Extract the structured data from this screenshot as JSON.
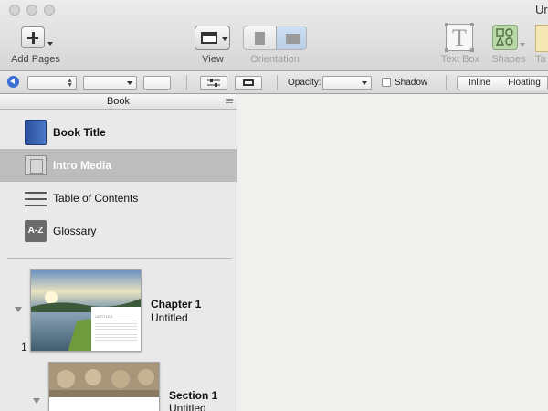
{
  "window": {
    "title": "Ur"
  },
  "toolbar": {
    "add_pages": "Add Pages",
    "view": "View",
    "orientation": "Orientation",
    "text_box": "Text Box",
    "shapes": "Shapes",
    "table_partial": "Ta"
  },
  "format_bar": {
    "opacity_label": "Opacity:",
    "shadow_label": "Shadow",
    "inline": "Inline",
    "floating": "Floating"
  },
  "sidebar": {
    "header": "Book",
    "items": [
      {
        "label": "Book Title",
        "icon": "book-icon"
      },
      {
        "label": "Intro Media",
        "icon": "film-icon",
        "selected": true
      },
      {
        "label": "Table of Contents",
        "icon": "list-icon"
      },
      {
        "label": "Glossary",
        "icon": "az-icon",
        "icon_text": "A-Z"
      }
    ],
    "chapters": [
      {
        "number": "1",
        "title": "Chapter 1",
        "subtitle": "Untitled",
        "thumb_caption": "UNTITLED"
      },
      {
        "title": "Section 1",
        "subtitle": "Untitled"
      }
    ]
  }
}
